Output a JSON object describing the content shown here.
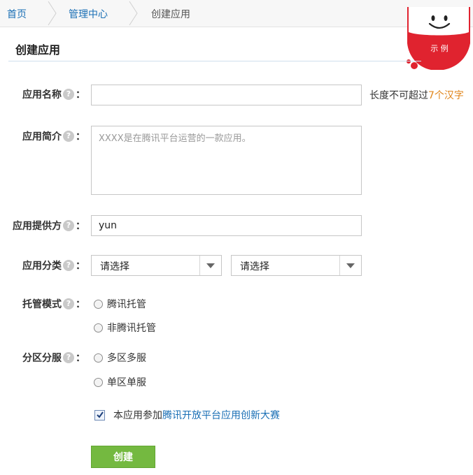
{
  "breadcrumb": {
    "home": "首页",
    "admin": "管理中心",
    "current": "创建应用"
  },
  "section_title": "创建应用",
  "badge": {
    "text": "示 例",
    "icon": "smiley-icon",
    "color": "#e0232f"
  },
  "form": {
    "name": {
      "label": "应用名称",
      "value": "",
      "hint_prefix": "长度不可超过",
      "hint_accent": "7个汉字"
    },
    "intro": {
      "label": "应用简介",
      "placeholder": "XXXX是在腾讯平台运营的一款应用。"
    },
    "provider": {
      "label": "应用提供方",
      "value": "yun"
    },
    "category": {
      "label": "应用分类",
      "select1": "请选择",
      "select2": "请选择"
    },
    "hosting": {
      "label": "托管模式",
      "options": [
        "腾讯托管",
        "非腾讯托管"
      ]
    },
    "zones": {
      "label": "分区分服",
      "options": [
        "多区多服",
        "单区单服"
      ]
    },
    "contest": {
      "prefix": "本应用参加",
      "link": "腾讯开放平台应用创新大赛",
      "checked": true
    },
    "colon": "：",
    "help_icon": "?"
  },
  "submit_label": "创建",
  "colors": {
    "accent": "#1a6fb5",
    "button": "#74b940",
    "hint": "#e0851b"
  }
}
